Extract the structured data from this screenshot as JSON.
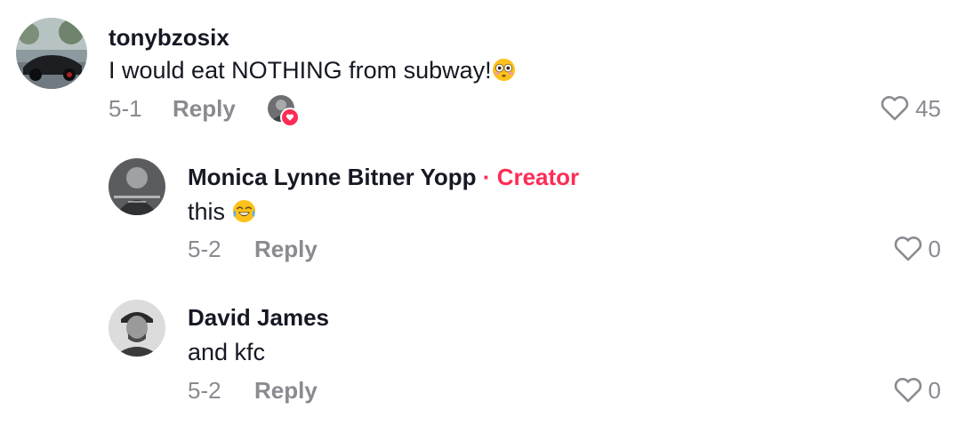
{
  "comments": [
    {
      "username": "tonybzosix",
      "text": "I would eat NOTHING from subway!",
      "emoji": "flushed-face-emoji",
      "date": "5-1",
      "reply_label": "Reply",
      "likes": "45",
      "liked_by_creator": true
    },
    {
      "username": "Monica Lynne Bitner Yopp",
      "separator": "·",
      "badge": "Creator",
      "text": "this",
      "emoji": "tears-of-joy-emoji",
      "date": "5-2",
      "reply_label": "Reply",
      "likes": "0"
    },
    {
      "username": "David James",
      "text": "and kfc",
      "date": "5-2",
      "reply_label": "Reply",
      "likes": "0"
    }
  ],
  "colors": {
    "creator": "#fe2c55",
    "meta": "#8a8b91",
    "text": "#161823"
  }
}
